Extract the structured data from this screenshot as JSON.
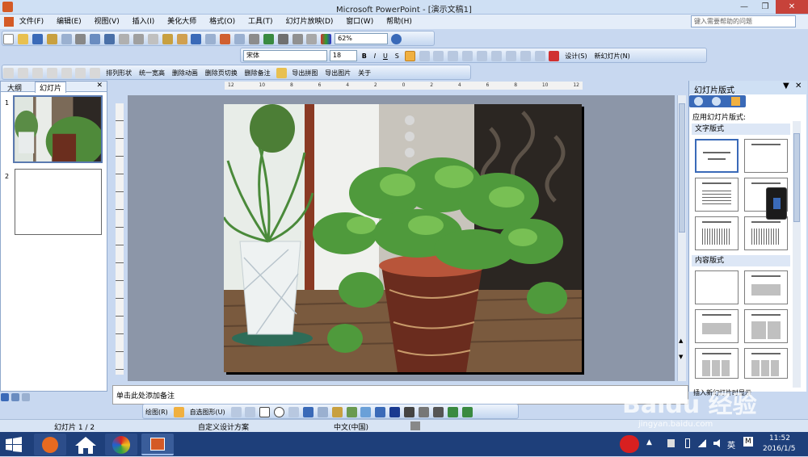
{
  "window": {
    "title": "Microsoft PowerPoint - [演示文稿1]"
  },
  "menu": {
    "items": [
      "文件(F)",
      "编辑(E)",
      "视图(V)",
      "插入(I)",
      "美化大师",
      "格式(O)",
      "工具(T)",
      "幻灯片放映(D)",
      "窗口(W)",
      "帮助(H)"
    ],
    "help_placeholder": "键入需要帮助的问题"
  },
  "standard_toolbar": {
    "zoom": "62%"
  },
  "format_toolbar": {
    "font": "宋体",
    "size": "18",
    "bold": "B",
    "italic": "I",
    "underline": "U",
    "shadow": "S",
    "design": "设计(S)",
    "new_slide": "新幻灯片(N)"
  },
  "beautify_toolbar": {
    "items": [
      "排列形状",
      "统一宽高",
      "删除动画",
      "删除页切换",
      "删除备注",
      "导出拼图",
      "导出图片",
      "关于"
    ]
  },
  "left_panel": {
    "tabs": [
      "大纲",
      "幻灯片"
    ],
    "slides": [
      "1",
      "2"
    ]
  },
  "ruler": {
    "labels": [
      "12",
      "10",
      "8",
      "6",
      "4",
      "2",
      "0",
      "2",
      "4",
      "6",
      "8",
      "10",
      "12"
    ]
  },
  "notes": {
    "placeholder": "单击此处添加备注"
  },
  "draw_toolbar": {
    "draw": "绘图(R)",
    "autoshapes": "自选图形(U)"
  },
  "task_pane": {
    "title": "幻灯片版式",
    "apply_label": "应用幻灯片版式:",
    "section_text": "文字版式",
    "section_content": "内容版式",
    "hint": "插入新幻灯片时显示"
  },
  "status": {
    "slide": "幻灯片 1 / 2",
    "design": "自定义设计方案",
    "language": "中文(中国)"
  },
  "taskbar": {
    "time": "11:52",
    "date": "2016/1/5",
    "ime": "英",
    "m": "M"
  },
  "watermark": {
    "line1": "Baidu 经验",
    "line2": "jingyan.baidu.com"
  },
  "colors": {
    "accent": "#3a6ab8",
    "taskbar": "#1e3f7a",
    "workspace": "#8c96a8"
  }
}
